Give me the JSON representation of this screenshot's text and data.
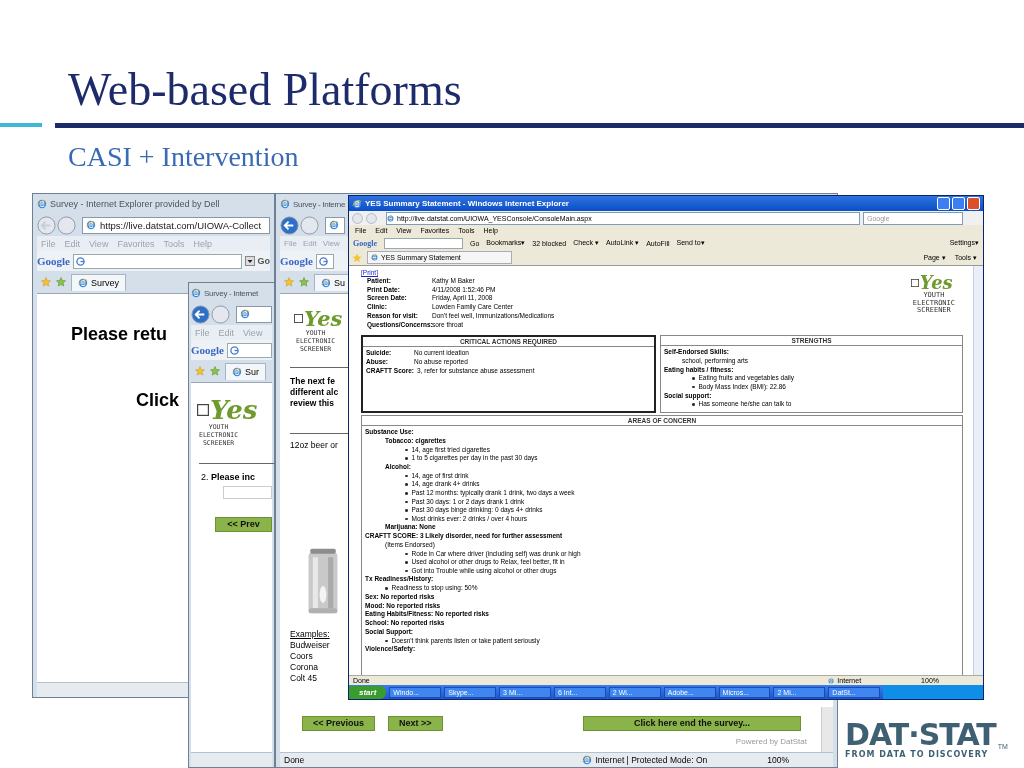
{
  "slide": {
    "title": "Web-based Platforms",
    "subtitle": "CASI + Intervention"
  },
  "survey_window_1": {
    "title": "Survey - Internet Explorer provided by Dell",
    "address": "https://live.datstat.com/UIOWA-Collect",
    "menu": [
      "File",
      "Edit",
      "View",
      "Favorites",
      "Tools",
      "Help"
    ],
    "search_brand": "Google",
    "search_button": "Go",
    "tab": "Survey",
    "lines": [
      "Please retu",
      "Click"
    ]
  },
  "survey_window_2": {
    "title": "Survey - Internet",
    "menu": [
      "File",
      "Edit",
      "View"
    ],
    "search_brand": "Google",
    "tab": "Sur",
    "logo": {
      "wordmark": "Yes",
      "tagline": [
        "YOUTH",
        "ELECTRONIC",
        "SCREENER"
      ]
    },
    "question": "2. **Please inc**",
    "button": "<< Prev"
  },
  "survey_window_3": {
    "title": "Survey - Interne",
    "menu": [
      "File",
      "Edit",
      "View"
    ],
    "search_brand": "Google",
    "tab": "Su",
    "logo": {
      "wordmark": "Yes",
      "tagline": [
        "YOUTH",
        "ELECTRONIC",
        "SCREENER"
      ]
    },
    "intro_lines": [
      "The next fe",
      "different alc",
      "review this"
    ],
    "drink": "12oz beer or",
    "examples_heading": "Examples:",
    "examples": [
      "Budweiser",
      "Coors",
      "Corona",
      "Colt 45"
    ],
    "nav_buttons": [
      "<< Previous",
      "Next >>"
    ],
    "finish_button": "Click here end the survey...",
    "powered_by": "Powered by DatStat",
    "status": "Done",
    "zone": "Internet | Protected Mode: On",
    "zoom": "100%"
  },
  "summary_window": {
    "title": "YES Summary Statement - Windows Internet Explorer",
    "address": "http://live.datstat.com/UIOWA_YESConsole/ConsoleMain.aspx",
    "search_placeholder": "Google",
    "menu": [
      "File",
      "Edit",
      "View",
      "Favorites",
      "Tools",
      "Help"
    ],
    "search_brand": "Google",
    "toolbar": [
      "Go",
      "Bookmarks▾",
      "32 blocked",
      "Check ▾",
      "AutoLink ▾",
      "AutoFill",
      "Send to▾"
    ],
    "settings": "Settings▾",
    "tab": "YES Summary Statement",
    "commands": [
      "Page ▾",
      "Tools ▾"
    ],
    "print_link": "[Print]",
    "patient": [
      {
        "label": "Patient:",
        "value": "Kathy M Baker"
      },
      {
        "label": "Print Date:",
        "value": "4/11/2008 1:52:46 PM"
      },
      {
        "label": "Screen Date:",
        "value": "Friday, April 11, 2008"
      },
      {
        "label": "Clinic:",
        "value": "Lowden Family Care Center"
      },
      {
        "label": "Reason for visit:",
        "value": "Don't feel well, Immunizations/Medications"
      },
      {
        "label": "Questions/Concerns:",
        "value": "sore throat"
      }
    ],
    "logo": {
      "wordmark": "Yes",
      "tagline": [
        "YOUTH",
        "ELECTRONIC",
        "SCREENER"
      ]
    },
    "critical": {
      "title": "CRITICAL ACTIONS REQUIRED",
      "rows": [
        {
          "label": "Suicide:",
          "value": "No current ideation"
        },
        {
          "label": "Abuse:",
          "value": "No abuse reported"
        },
        {
          "label": "CRAFTT Score:",
          "value": "3, refer for substance abuse assessment"
        }
      ]
    },
    "strengths": {
      "title": "STRENGTHS",
      "sections": [
        {
          "heading": "Self-Endorsed Skills:",
          "lines": [
            {
              "kind": "text",
              "text": "school, performing arts"
            }
          ]
        },
        {
          "heading": "Eating habits / fitness:",
          "lines": [
            {
              "kind": "bullet",
              "text": "Eating fruits and vegetables daily"
            },
            {
              "kind": "bullet",
              "text": "Body Mass Index (BMI): 22.86"
            }
          ]
        },
        {
          "heading": "Social support:",
          "lines": [
            {
              "kind": "bullet",
              "text": "Has someone he/she can talk to"
            }
          ]
        }
      ]
    },
    "concerns": {
      "title": "AREAS OF CONCERN",
      "items": [
        {
          "kind": "heading",
          "text": "Substance Use:",
          "children": [
            {
              "kind": "heading",
              "text": "Tobacco: cigarettes",
              "children": [
                {
                  "kind": "bullet",
                  "text": "14, age first tried cigarettes"
                },
                {
                  "kind": "bullet",
                  "text": "1 to 5 cigarettes per day in the past 30 days"
                }
              ]
            },
            {
              "kind": "heading",
              "text": "Alcohol:",
              "children": [
                {
                  "kind": "bullet",
                  "text": "14, age of first drink"
                },
                {
                  "kind": "bullet",
                  "text": "14, age drank 4+ drinks"
                },
                {
                  "kind": "bullet",
                  "text": "Past 12 months: typically drank 1 drink, two days a week"
                },
                {
                  "kind": "bullet",
                  "text": "Past 30 days: 1 or 2 days drank 1 drink"
                },
                {
                  "kind": "bullet",
                  "text": "Past 30 days binge drinking: 0 days 4+ drinks"
                },
                {
                  "kind": "bullet",
                  "text": "Most drinks ever: 2 drinks / over 4 hours"
                }
              ]
            },
            {
              "kind": "heading",
              "text": "Marijuana: None"
            }
          ]
        },
        {
          "kind": "heading",
          "text": "CRAFTT SCORE: 3 Likely disorder, need for further assessment",
          "children": [
            {
              "kind": "note",
              "text": "(Items Endorsed)",
              "children": [
                {
                  "kind": "bullet",
                  "text": "Rode in Car where driver (including self) was drunk or high"
                },
                {
                  "kind": "bullet",
                  "text": "Used alcohol or other drugs to Relax, feel better, fit in"
                },
                {
                  "kind": "bullet",
                  "text": "Got into Trouble while using alcohol or other drugs"
                }
              ]
            }
          ]
        },
        {
          "kind": "heading",
          "text": "Tx Readiness/History:",
          "children": [
            {
              "kind": "bullet",
              "text": "Readiness to stop using: 50%"
            }
          ]
        },
        {
          "kind": "heading",
          "text": "Sex: No reported risks"
        },
        {
          "kind": "heading",
          "text": "Mood: No reported risks"
        },
        {
          "kind": "heading",
          "text": "Eating Habits/Fitness: No reported risks"
        },
        {
          "kind": "heading",
          "text": "School: No reported risks"
        },
        {
          "kind": "heading",
          "text": "Social Support:",
          "children": [
            {
              "kind": "bullet",
              "text": "Doesn't think parents listen or take patient seriously"
            }
          ]
        },
        {
          "kind": "heading",
          "text": "Violence/Safety:"
        }
      ]
    },
    "status": "Done",
    "zone": "Internet",
    "zoom": "100%"
  },
  "taskbar": {
    "start": "start",
    "tasks": [
      "Windo...",
      "Skype...",
      "3 Mi...",
      "6 Int...",
      "2 Wi...",
      "Adobe...",
      "Micros...",
      "2 Mi...",
      "DatSt..."
    ]
  },
  "datstat_logo": {
    "wordmark": "DAT·STAT",
    "trademark": "TM",
    "tagline": "FROM DATA TO DISCOVERY"
  }
}
